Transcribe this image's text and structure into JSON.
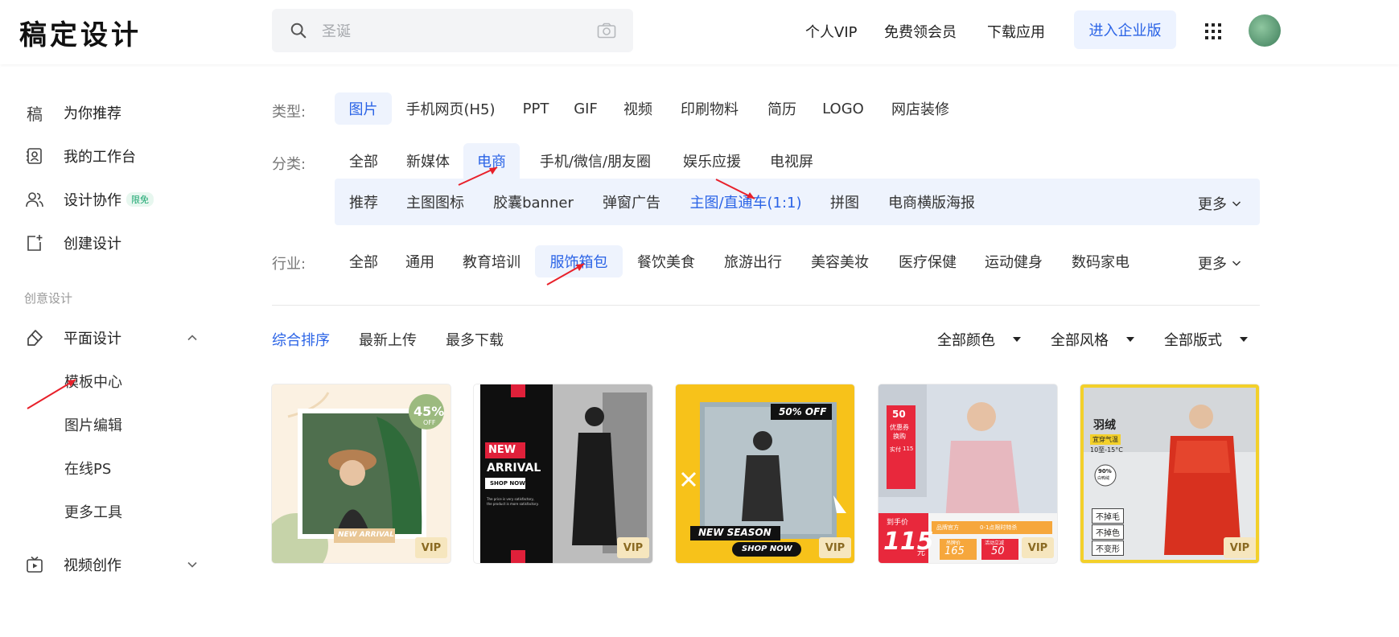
{
  "header": {
    "logo": "稿定设计",
    "search_placeholder": "圣诞",
    "nav": [
      "个人VIP",
      "免费领会员",
      "下载应用"
    ],
    "enterprise_button": "进入企业版"
  },
  "sidebar": {
    "items": [
      {
        "label": "为你推荐",
        "icon": "gaoding-logo-icon",
        "glyph": "稿"
      },
      {
        "label": "我的工作台",
        "icon": "workspace-icon"
      },
      {
        "label": "设计协作",
        "icon": "collaboration-icon",
        "badge": "限免"
      },
      {
        "label": "创建设计",
        "icon": "create-design-icon"
      }
    ],
    "section_title": "创意设计",
    "graphic_design": {
      "label": "平面设计",
      "expanded": true,
      "children": [
        "模板中心",
        "图片编辑",
        "在线PS",
        "更多工具"
      ]
    },
    "video": {
      "label": "视频创作",
      "expanded": false
    }
  },
  "filters": {
    "type": {
      "label": "类型:",
      "options": [
        "图片",
        "手机网页(H5)",
        "PPT",
        "GIF",
        "视频",
        "印刷物料",
        "简历",
        "LOGO",
        "网店装修"
      ],
      "selected": "图片"
    },
    "category": {
      "label": "分类:",
      "options": [
        "全部",
        "新媒体",
        "电商",
        "手机/微信/朋友圈",
        "娱乐应援",
        "电视屏"
      ],
      "selected": "电商",
      "sub_options": [
        "推荐",
        "主图图标",
        "胶囊banner",
        "弹窗广告",
        "主图/直通车(1:1)",
        "拼图",
        "电商横版海报"
      ],
      "sub_selected": "主图/直通车(1:1)",
      "more": "更多"
    },
    "industry": {
      "label": "行业:",
      "options": [
        "全部",
        "通用",
        "教育培训",
        "服饰箱包",
        "餐饮美食",
        "旅游出行",
        "美容美妆",
        "医疗保健",
        "运动健身",
        "数码家电"
      ],
      "selected": "服饰箱包",
      "more": "更多"
    }
  },
  "sort": {
    "options": [
      "综合排序",
      "最新上传",
      "最多下载"
    ],
    "selected": "综合排序",
    "dropdowns": [
      "全部颜色",
      "全部风格",
      "全部版式"
    ]
  },
  "templates": [
    {
      "badge": "VIP",
      "texts": [
        "45%",
        "OFF",
        "NEW ARRIVAL"
      ]
    },
    {
      "badge": "VIP",
      "texts": [
        "NEW",
        "ARRIVAL",
        "SHOP NOW",
        "The price is very satisfactory,",
        "the product is more satisfactory."
      ]
    },
    {
      "badge": "VIP",
      "texts": [
        "50% OFF",
        "NEW SEASON",
        "SHOP NOW"
      ]
    },
    {
      "badge": "VIP",
      "texts": [
        "50",
        "优惠券",
        "换购",
        "实付",
        "115",
        "到手价",
        "115",
        "元",
        "品牌官方",
        "0-1点限时特杀",
        "吊牌价",
        "165",
        "活动立减",
        "50",
        "115"
      ]
    },
    {
      "badge": "VIP",
      "texts": [
        "羽绒",
        "宜穿气温",
        "10至-15°C",
        "90%",
        "白鸭绒",
        "不掉毛",
        "不掉色",
        "不变形"
      ]
    }
  ],
  "colors": {
    "accent": "#2a63e6",
    "active_bg": "#eef3fd",
    "vip_bg": "#f6e6be",
    "annotation_arrow": "#e8202a"
  }
}
